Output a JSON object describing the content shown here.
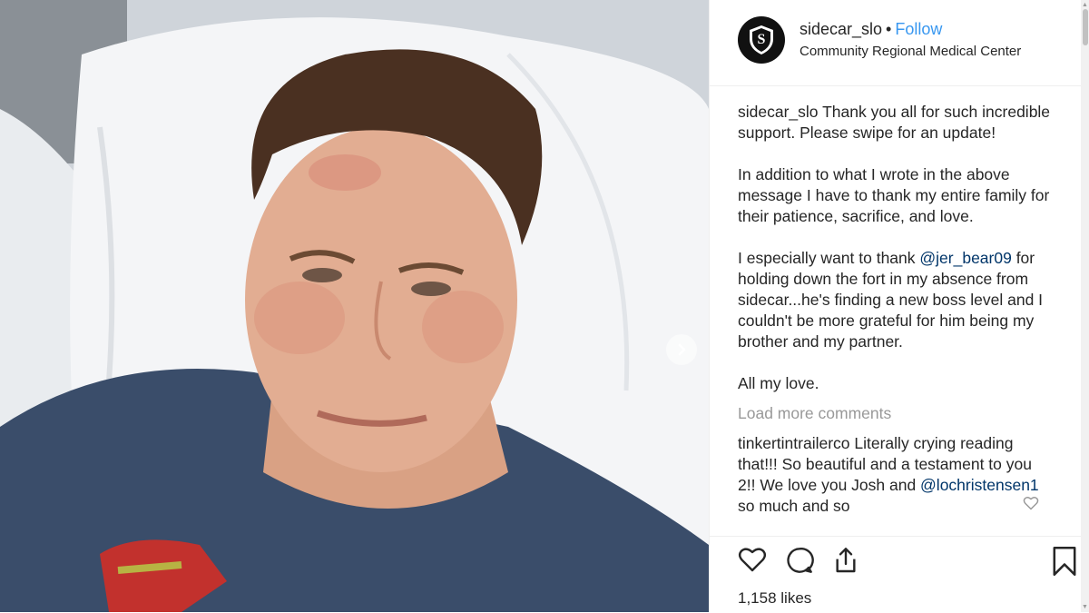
{
  "post": {
    "username": "sidecar_slo",
    "separator": "•",
    "follow_label": "Follow",
    "location": "Community Regional Medical Center",
    "avatar_letter": "S"
  },
  "caption": {
    "user": "sidecar_slo",
    "para1": "Thank you all for such incredible support. Please swipe for an update!",
    "para2": "In addition to what I wrote in the above message I have to thank my entire family for their patience, sacrifice, and love.",
    "para3_pre": "I especially want to thank ",
    "para3_mention": "@jer_bear09",
    "para3_post": " for holding down the fort in my absence from sidecar...he's finding a new boss level and I couldn't be more grateful for him being my brother and my partner.",
    "para4": "All my love."
  },
  "load_more_label": "Load more comments",
  "comment": {
    "user": "tinkertintrailerco",
    "text_pre": " Literally crying reading that!!! So beautiful and a testament to you 2!! We love you Josh and ",
    "mention": "@lochristensen1",
    "text_post": " so much and so"
  },
  "likes_label": "1,158 likes",
  "icons": {
    "like": "heart-icon",
    "comment": "comment-icon",
    "share": "share-icon",
    "save": "bookmark-icon",
    "next": "chevron-right-icon"
  },
  "colors": {
    "follow": "#3897f0",
    "mention": "#003569",
    "muted": "#999999"
  }
}
